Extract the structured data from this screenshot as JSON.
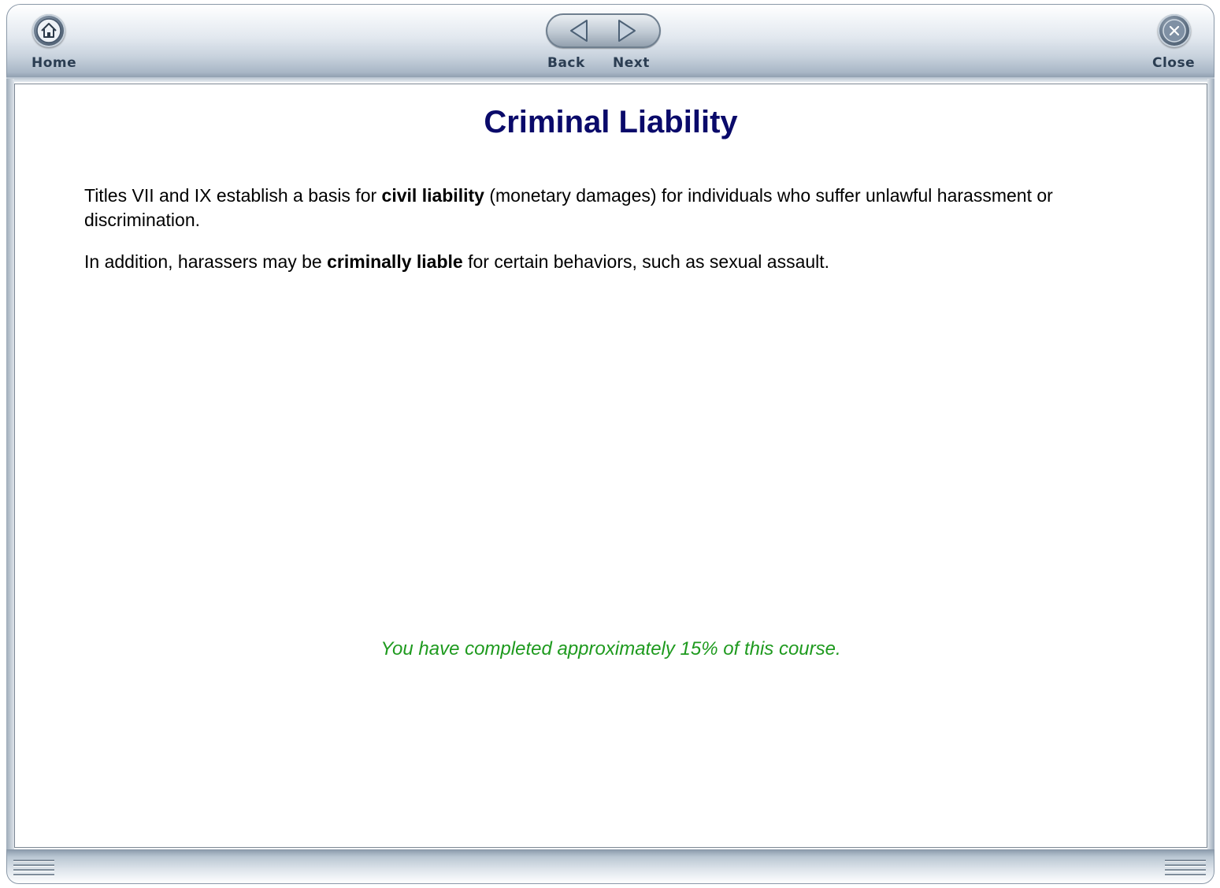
{
  "toolbar": {
    "home_label": "Home",
    "back_label": "Back",
    "next_label": "Next",
    "close_label": "Close",
    "home_icon": "home-icon",
    "back_icon": "arrow-left-icon",
    "next_icon": "arrow-right-icon",
    "close_icon": "close-icon"
  },
  "page": {
    "title": "Criminal Liability",
    "paragraph1": {
      "before": "Titles VII and IX establish a basis for ",
      "bold": "civil liability",
      "after": " (monetary damages) for individuals who suffer unlawful harassment or discrimination."
    },
    "paragraph2": {
      "before": "In addition, harassers may be ",
      "bold": "criminally liable",
      "after": " for certain behaviors, such as sexual assault."
    },
    "progress": {
      "text": "You have completed approximately 15% of this course.",
      "percent": 15
    }
  },
  "colors": {
    "title": "#0a0a6a",
    "progress": "#1e9a1e",
    "toolbar_label": "#2b3d52"
  }
}
